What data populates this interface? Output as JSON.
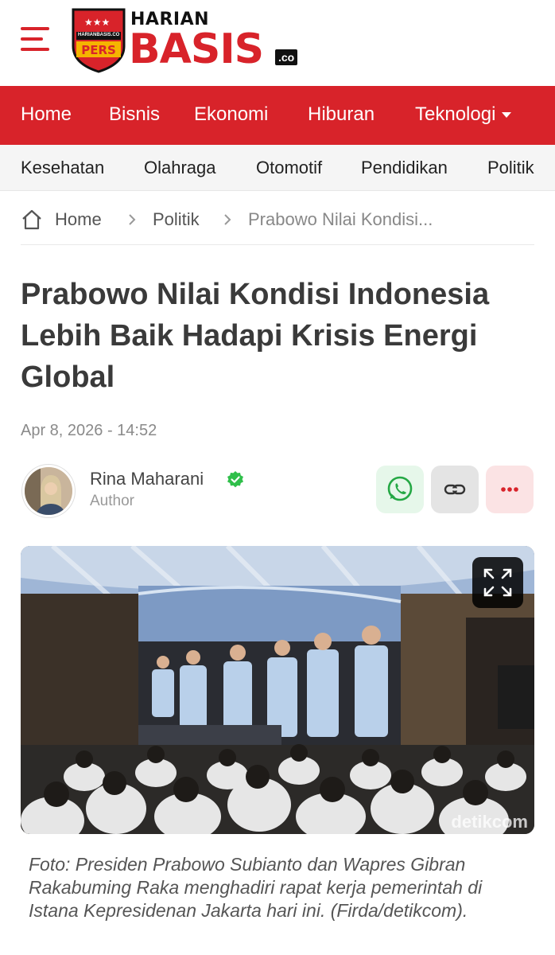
{
  "header": {
    "logo_top": "HARIAN",
    "logo_main": "BASIS",
    "logo_domain": ".co",
    "shield_text": "HARIANBASIS.CO",
    "shield_badge": "PERS",
    "brand_color": "#d8232a"
  },
  "nav": {
    "items": [
      "Home",
      "Bisnis",
      "Ekonomi",
      "Hiburan",
      "Teknologi"
    ]
  },
  "subnav": {
    "items": [
      "Kesehatan",
      "Olahraga",
      "Otomotif",
      "Pendidikan",
      "Politik"
    ]
  },
  "breadcrumb": {
    "home": "Home",
    "section": "Politik",
    "current": "Prabowo Nilai Kondisi..."
  },
  "article": {
    "title": "Prabowo Nilai Kondisi Indonesia Lebih Baik Hadapi Krisis Energi Global",
    "date": "Apr 8, 2026 - 14:52",
    "author_name": "Rina Maharani",
    "author_role": "Author",
    "image_watermark": "detikcom",
    "caption": "Foto: Presiden Prabowo Subianto dan Wapres Gibran Rakabuming Raka menghadiri rapat kerja pemerintah di Istana Kepresidenan Jakarta hari ini. (Firda/detikcom)."
  },
  "icons": {
    "menu": "hamburger-icon",
    "home": "home-icon",
    "verified": "verified-badge-icon",
    "whatsapp": "whatsapp-icon",
    "link": "link-icon",
    "more": "more-dots-icon",
    "expand": "expand-icon"
  }
}
